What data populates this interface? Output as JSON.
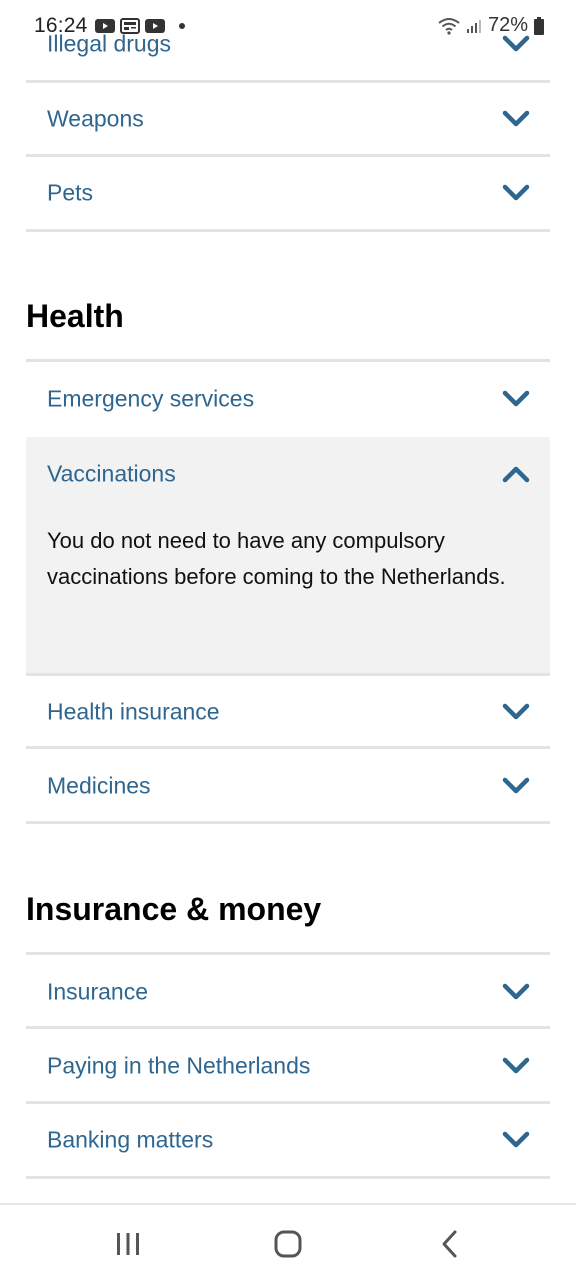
{
  "status_bar": {
    "time": "16:24",
    "battery": "72%",
    "left_icons": [
      "youtube-icon",
      "news-icon",
      "youtube-icon"
    ],
    "right_icons": [
      "wifi-icon",
      "signal-icon",
      "battery-icon"
    ]
  },
  "accent_color": "#2f6690",
  "top_section": {
    "items": [
      {
        "label": "Illegal drugs",
        "expanded": false
      },
      {
        "label": "Weapons",
        "expanded": false
      },
      {
        "label": "Pets",
        "expanded": false
      }
    ]
  },
  "health": {
    "heading": "Health",
    "items": [
      {
        "label": "Emergency services",
        "expanded": false
      },
      {
        "label": "Vaccinations",
        "expanded": true,
        "body": "You do not need to have any compulsory vaccinations before coming to the Netherlands."
      },
      {
        "label": "Health insurance",
        "expanded": false
      },
      {
        "label": "Medicines",
        "expanded": false
      }
    ]
  },
  "insurance": {
    "heading": "Insurance & money",
    "items": [
      {
        "label": "Insurance",
        "expanded": false
      },
      {
        "label": "Paying in the Netherlands",
        "expanded": false
      },
      {
        "label": "Banking matters",
        "expanded": false
      }
    ]
  },
  "nav_bar": {
    "buttons": [
      "recent-apps-icon",
      "home-icon",
      "back-icon"
    ]
  }
}
